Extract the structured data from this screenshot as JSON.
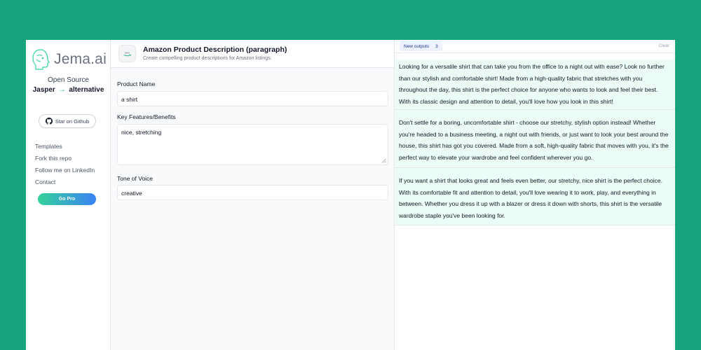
{
  "sidebar": {
    "logo_text": "Jema.ai",
    "tagline_top": "Open Source",
    "tagline_left": "Jasper",
    "tagline_arrow": "→",
    "tagline_right": "alternative",
    "github_label": "Star on Github",
    "nav": [
      "Templates",
      "Fork this repo",
      "Follow me on LinkedIn",
      "Contact"
    ],
    "go_pro_label": "Go Pro"
  },
  "form": {
    "title": "Amazon Product Description (paragraph)",
    "description": "Create compelling product descriptions for Amazon listings.",
    "product_name_label": "Product Name",
    "product_name_value": "a shirt",
    "features_label": "Key Features/Benefits",
    "features_value": "nice, stretching",
    "tone_label": "Tone of Voice",
    "tone_value": "creative"
  },
  "output": {
    "tab_label": "New outputs",
    "count": "3",
    "clear_label": "Clear",
    "items": [
      "Looking for a versatile shirt that can take you from the office to a night out with ease? Look no further than our stylish and comfortable shirt! Made from a high-quality fabric that stretches with you throughout the day, this shirt is the perfect choice for anyone who wants to look and feel their best. With its classic design and attention to detail, you'll love how you look in this shirt!",
      "Don't settle for a boring, uncomfortable shirt - choose our stretchy, stylish option instead! Whether you're headed to a business meeting, a night out with friends, or just want to look your best around the house, this shirt has got you covered. Made from a soft, high-quality fabric that moves with you, it's the perfect way to elevate your wardrobe and feel confident wherever you go.",
      "If you want a shirt that looks great and feels even better, our stretchy, nice shirt is the perfect choice. With its comfortable fit and attention to detail, you'll love wearing it to work, play, and everything in between. Whether you dress it up with a blazer or dress it down with shorts, this shirt is the versatile wardrobe staple you've been looking for."
    ]
  },
  "colors": {
    "background": "#17a37c",
    "output_bg": "#ecfdf5",
    "accent_green": "#10b981",
    "accent_blue": "#3b82f6"
  }
}
